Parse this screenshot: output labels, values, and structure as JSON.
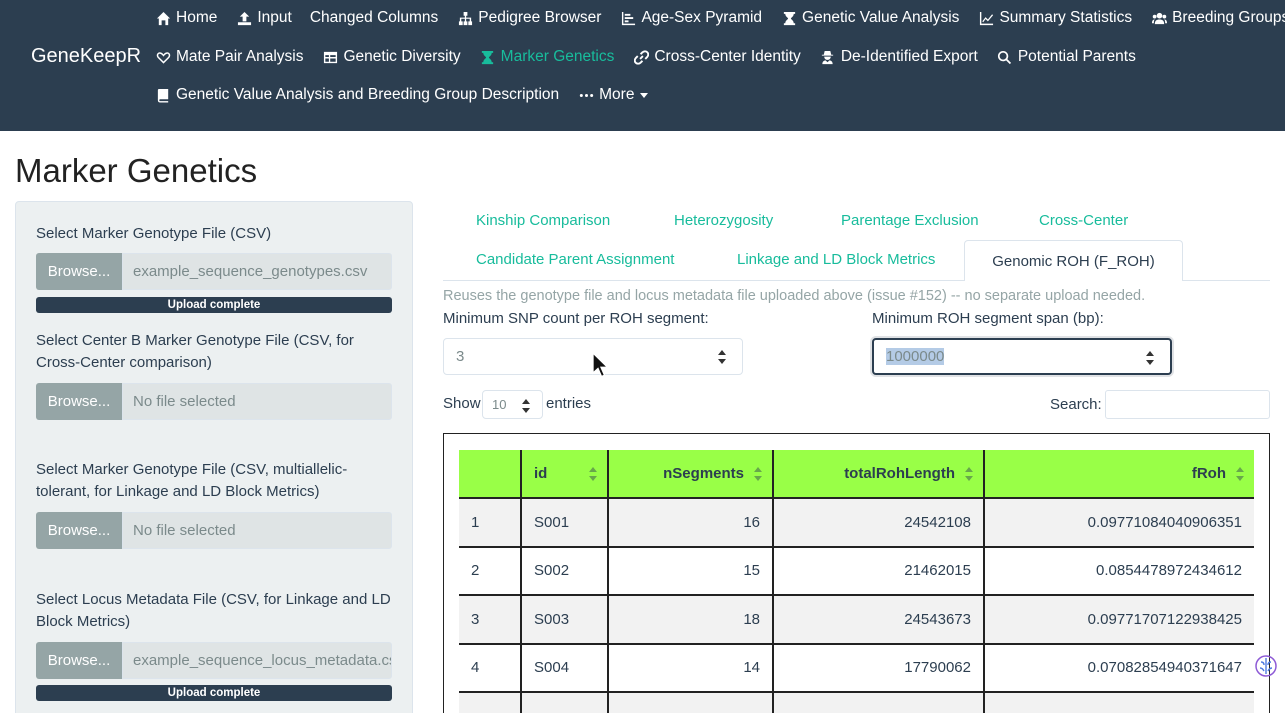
{
  "navbar": {
    "brand": "GeneKeepR",
    "row1": [
      {
        "label": "Home",
        "icon": "home-icon"
      },
      {
        "label": "Input",
        "icon": "upload-icon"
      },
      {
        "label": "Changed Columns",
        "icon": ""
      },
      {
        "label": "Pedigree Browser",
        "icon": "sitemap-icon"
      },
      {
        "label": "Age-Sex Pyramid",
        "icon": "chart-bar-icon"
      },
      {
        "label": "Genetic Value Analysis",
        "icon": "hourglass-icon"
      },
      {
        "label": "Summary Statistics",
        "icon": "line-chart-icon"
      },
      {
        "label": "Breeding Groups",
        "icon": "users-icon"
      }
    ],
    "row2": [
      {
        "label": "Mate Pair Analysis",
        "icon": "heart-icon"
      },
      {
        "label": "Genetic Diversity",
        "icon": "table-icon"
      },
      {
        "label": "Marker Genetics",
        "icon": "hourglass-icon",
        "active": true
      },
      {
        "label": "Cross-Center Identity",
        "icon": "link-icon"
      },
      {
        "label": "De-Identified Export",
        "icon": "user-secret-icon"
      },
      {
        "label": "Potential Parents",
        "icon": "search-icon"
      }
    ],
    "row3": [
      {
        "label": "Genetic Value Analysis and Breeding Group Description",
        "icon": "book-icon"
      },
      {
        "label": "More",
        "icon": "ellipsis-icon"
      }
    ],
    "accent_color": "#18bc9c",
    "background": "#2c3e50"
  },
  "page_title": "Marker Genetics",
  "sidebar": {
    "browse_label": "Browse...",
    "upload_complete": "Upload complete",
    "fields": [
      {
        "label": "Select Marker Genotype File (CSV)",
        "file": "example_sequence_genotypes.csv",
        "uploaded": true
      },
      {
        "label": "Select Center B Marker Genotype File (CSV, for Cross-Center comparison)",
        "file": "No file selected",
        "uploaded": false
      },
      {
        "label": "Select Marker Genotype File (CSV, multiallelic-tolerant, for Linkage and LD Block Metrics)",
        "file": "No file selected",
        "uploaded": false
      },
      {
        "label": "Select Locus Metadata File (CSV, for Linkage and LD Block Metrics)",
        "file": "example_sequence_locus_metadata.csv",
        "uploaded": true
      }
    ]
  },
  "tabs": {
    "items": [
      "Kinship Comparison",
      "Heterozygosity",
      "Parentage Exclusion",
      "Cross-Center",
      "Candidate Parent Assignment",
      "Linkage and LD Block Metrics",
      "Genomic ROH (F_ROH)"
    ],
    "active": "Genomic ROH (F_ROH)"
  },
  "roh": {
    "help_text": "Reuses the genotype file and locus metadata file uploaded above (issue #152) -- no separate upload needed.",
    "min_snp_label": "Minimum SNP count per ROH segment:",
    "min_snp_value": "3",
    "min_span_label": "Minimum ROH segment span (bp):",
    "min_span_value": "1000000"
  },
  "datatable": {
    "show_label": "Show",
    "entries_value": "10",
    "entries_label": "entries",
    "search_label": "Search:",
    "header_color": "#99ff47",
    "columns": [
      "",
      "id",
      "nSegments",
      "totalRohLength",
      "fRoh"
    ],
    "rows": [
      [
        "1",
        "S001",
        "16",
        "24542108",
        "0.09771084040906351"
      ],
      [
        "2",
        "S002",
        "15",
        "21462015",
        "0.0854478972434612"
      ],
      [
        "3",
        "S003",
        "18",
        "24543673",
        "0.09771707122938425"
      ],
      [
        "4",
        "S004",
        "14",
        "17790062",
        "0.07082854940371647"
      ],
      [
        "",
        "",
        "",
        "",
        ""
      ]
    ]
  }
}
